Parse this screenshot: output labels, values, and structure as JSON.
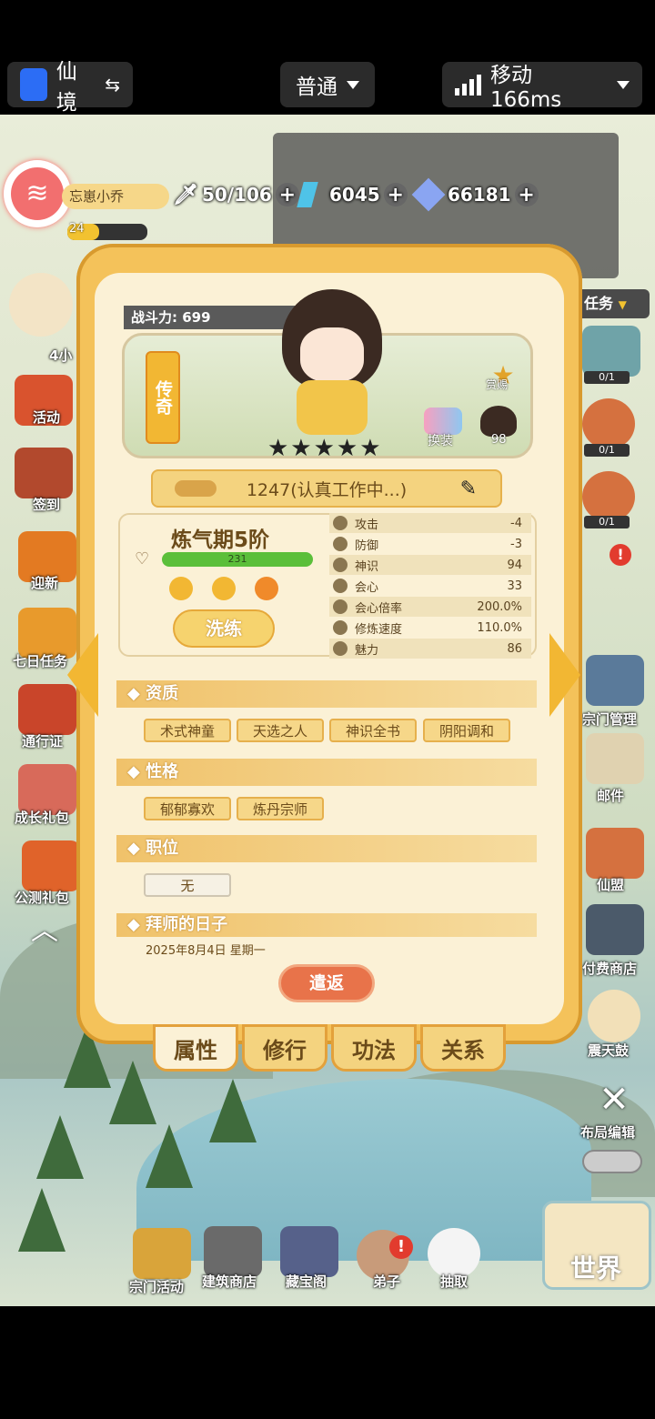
{
  "status_bar": {
    "app_label": "仙境",
    "app_switch_glyph": "⇆",
    "mode_label": "普通",
    "network_label": "移动 166ms"
  },
  "player": {
    "name": "忘崽小乔",
    "level": "24"
  },
  "resources": {
    "stamina": "50/106",
    "jade": "6045",
    "crystal": "66181"
  },
  "left_menu": [
    {
      "label": "4小"
    },
    {
      "label": "活动"
    },
    {
      "label": "签到"
    },
    {
      "label": "迎新"
    },
    {
      "label": "七日任务"
    },
    {
      "label": "通行证"
    },
    {
      "label": "成长礼包"
    },
    {
      "label": "公测礼包"
    }
  ],
  "right_menu": {
    "task_label": "任务",
    "progress": [
      "0/1",
      "0/1",
      "0/1"
    ],
    "items": [
      {
        "label": "宗门管理"
      },
      {
        "label": "邮件"
      },
      {
        "label": "仙盟"
      },
      {
        "label": "付费商店"
      },
      {
        "label": "震天鼓"
      },
      {
        "label": "布局编辑"
      }
    ]
  },
  "bottom_nav": [
    {
      "label": "宗门活动"
    },
    {
      "label": "建筑商店"
    },
    {
      "label": "藏宝阁"
    },
    {
      "label": "弟子"
    },
    {
      "label": "抽取"
    },
    {
      "label": "世界"
    }
  ],
  "dialog": {
    "combat_power": "战斗力: 699",
    "rarity_tag": "传奇",
    "portrait_badge_1": "赏赐",
    "portrait_badge_2": "换装",
    "portrait_badge_3": "98",
    "stars": "★★★★★",
    "work_status": "1247(认真工作中...)",
    "realm": "炼气期5阶",
    "hp_value": "231",
    "hp_fraction": 1.0,
    "wash_button": "洗练",
    "stats": [
      {
        "name": "攻击",
        "value": "-4"
      },
      {
        "name": "防御",
        "value": "-3"
      },
      {
        "name": "神识",
        "value": "94"
      },
      {
        "name": "会心",
        "value": "33"
      },
      {
        "name": "会心倍率",
        "value": "200.0%"
      },
      {
        "name": "修炼速度",
        "value": "110.0%"
      },
      {
        "name": "魅力",
        "value": "86"
      }
    ],
    "sections": {
      "aptitude": "◆ 资质",
      "personality": "◆ 性格",
      "position": "◆ 职位",
      "apprentice_date": "◆ 拜师的日子"
    },
    "aptitude_tags": [
      "术式神童",
      "天选之人",
      "神识全书",
      "阴阳调和"
    ],
    "personality_tags": [
      "郁郁寡欢",
      "炼丹宗师"
    ],
    "position_value": "无",
    "apprentice_date_value": "2025年8月4日 星期一",
    "dismiss_button": "遣返",
    "tabs": [
      "属性",
      "修行",
      "功法",
      "关系"
    ]
  },
  "colors": {
    "panel_gold": "#f4c25a",
    "panel_cream": "#fbf1d6",
    "hp_green": "#5bbf3a",
    "dismiss_red": "#e8734a"
  }
}
